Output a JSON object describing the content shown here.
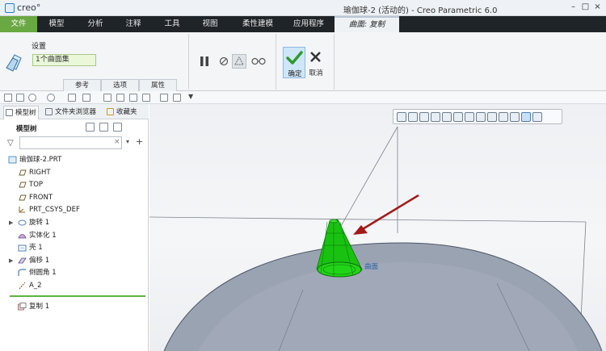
{
  "app": {
    "logo": "creo°",
    "window_title": "瑜伽球-2 (活动的) - Creo Parametric 6.0",
    "window_buttons": [
      "–",
      "□",
      "×"
    ]
  },
  "menu": {
    "items": [
      "文件",
      "模型",
      "分析",
      "注释",
      "工具",
      "视图",
      "柔性建模",
      "应用程序"
    ],
    "active_context_tab": "曲面: 复制"
  },
  "ribbon": {
    "settings_label": "设置",
    "settings_value": "1个曲面集",
    "subtabs": [
      "参考",
      "选项",
      "属性"
    ],
    "ok_label": "确定",
    "cancel_label": "取消"
  },
  "left_panel": {
    "tabs": [
      "模型树",
      "文件夹浏览器",
      "收藏夹"
    ],
    "tree_title": "模型树",
    "search_placeholder": "",
    "tree": [
      {
        "label": "瑜伽球-2.PRT",
        "icon": "part-icon",
        "expander": ""
      },
      {
        "label": "RIGHT",
        "icon": "datum-plane-icon",
        "expander": ""
      },
      {
        "label": "TOP",
        "icon": "datum-plane-icon",
        "expander": ""
      },
      {
        "label": "FRONT",
        "icon": "datum-plane-icon",
        "expander": ""
      },
      {
        "label": "PRT_CSYS_DEF",
        "icon": "csys-icon",
        "expander": ""
      },
      {
        "label": "旋转 1",
        "icon": "revolve-icon",
        "expander": "▶"
      },
      {
        "label": "实体化 1",
        "icon": "solidify-icon",
        "expander": ""
      },
      {
        "label": "壳 1",
        "icon": "shell-icon",
        "expander": ""
      },
      {
        "label": "偏移 1",
        "icon": "offset-icon",
        "expander": "▶"
      },
      {
        "label": "倒圆角 1",
        "icon": "round-icon",
        "expander": ""
      },
      {
        "label": "A_2",
        "icon": "axis-icon",
        "expander": ""
      }
    ],
    "insert_item": {
      "label": "复制 1",
      "icon": "copy-icon"
    }
  },
  "viewport": {
    "surface_label": "曲面",
    "colors": {
      "sphere": "#9aa3b2",
      "cone": "#19c210",
      "arrow": "#a31818"
    }
  }
}
